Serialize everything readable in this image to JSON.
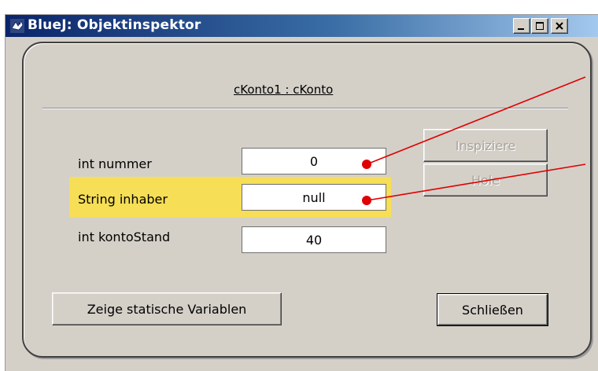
{
  "window": {
    "title": "BlueJ: Objektinspektor",
    "icon": "bluej-bird-icon",
    "controls": [
      "minimize",
      "maximize",
      "close"
    ]
  },
  "inspector": {
    "object_title": "cKonto1 : cKonto",
    "fields": [
      {
        "label": "int nummer",
        "value": "0"
      },
      {
        "label": "String inhaber",
        "value": "null"
      },
      {
        "label": "int kontoStand",
        "value": "40"
      }
    ],
    "inspect_label": "Inspiziere",
    "get_label": "Hole",
    "show_static_label": "Zeige statische Variablen",
    "close_label": "Schließen"
  },
  "colors": {
    "title_bar": "#0a246a",
    "window_bg": "#d4d0c8",
    "highlight": "#f6de56",
    "annotation": "#e00000"
  }
}
